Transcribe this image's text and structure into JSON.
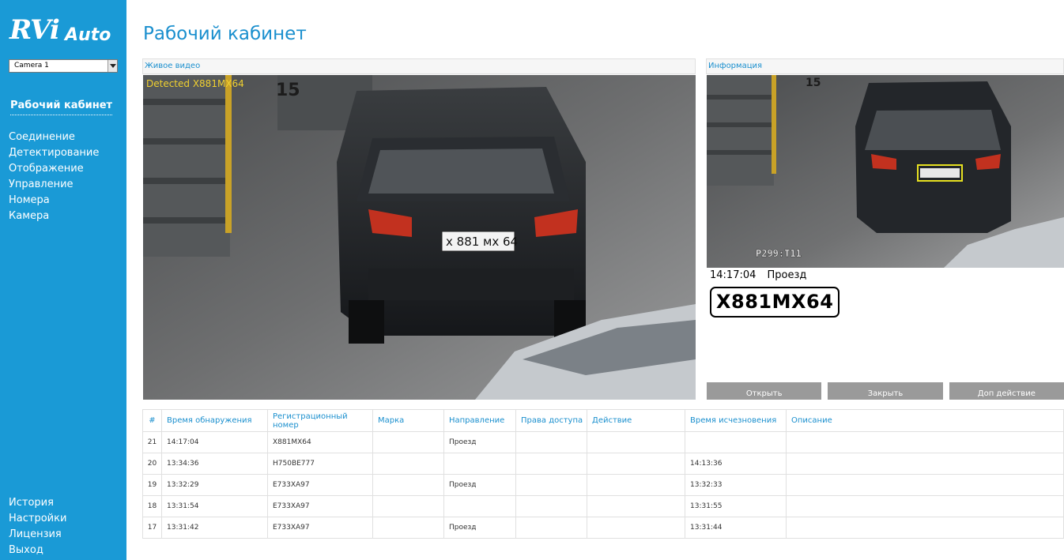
{
  "app": {
    "logo_rv": "RVi",
    "logo_auto": "Auto",
    "page_title": "Рабочий кабинет"
  },
  "camera_select": {
    "value": "Camera 1"
  },
  "nav": {
    "active": "Рабочий кабинет",
    "main": [
      "Соединение",
      "Детектирование",
      "Отображение",
      "Управление",
      "Номера",
      "Камера"
    ],
    "bottom": [
      "История",
      "Настройки",
      "Лицензия",
      "Выход"
    ]
  },
  "live": {
    "header": "Живое видео",
    "detected": "Detected X881MX64",
    "plate_text": "x 881 мх 64",
    "wall_number": "15"
  },
  "info": {
    "header": "Информация",
    "time": "14:17:04",
    "direction": "Проезд",
    "plate": "X881MX64",
    "overlay_code": "P299:T11",
    "wall_number": "15",
    "buttons": [
      "Открыть",
      "Закрыть",
      "Доп действие"
    ]
  },
  "table": {
    "columns": [
      "#",
      "Время обнаружения",
      "Регистрационный номер",
      "Марка",
      "Направление",
      "Права доступа",
      "Действие",
      "Время исчезновения",
      "Описание"
    ],
    "rows": [
      [
        "21",
        "14:17:04",
        "X881MX64",
        "",
        "Проезд",
        "",
        "",
        "",
        ""
      ],
      [
        "20",
        "13:34:36",
        "H750BE777",
        "",
        "",
        "",
        "",
        "14:13:36",
        ""
      ],
      [
        "19",
        "13:32:29",
        "E733XA97",
        "",
        "Проезд",
        "",
        "",
        "13:32:33",
        ""
      ],
      [
        "18",
        "13:31:54",
        "E733XA97",
        "",
        "",
        "",
        "",
        "13:31:55",
        ""
      ],
      [
        "17",
        "13:31:42",
        "E733XA97",
        "",
        "Проезд",
        "",
        "",
        "13:31:44",
        ""
      ]
    ]
  },
  "colors": {
    "sidebar": "#1a9ad6",
    "accent_text": "#1a8fce",
    "detected_text": "#f0d030",
    "button_bg": "#9a9a9a",
    "plate_highlight": "#e6e020"
  }
}
